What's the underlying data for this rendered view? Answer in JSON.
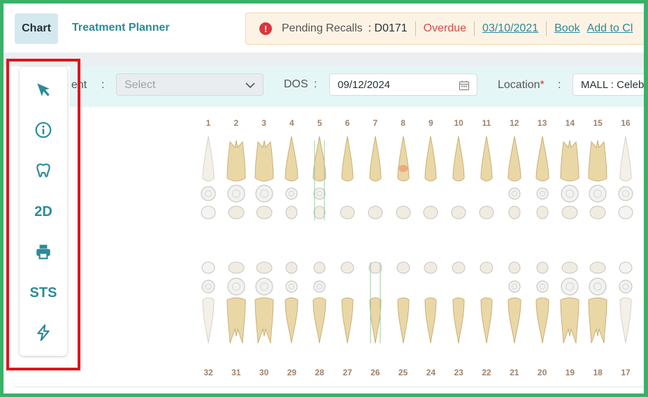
{
  "tabs": {
    "chart": "Chart",
    "planner": "Treatment Planner"
  },
  "recall": {
    "label": "Pending Recalls",
    "code": ": D0171",
    "status": "Overdue",
    "date": "03/10/2021",
    "book": "Book",
    "add": "Add to Cl"
  },
  "form": {
    "patient_label": "ent",
    "colon": ":",
    "select_placeholder": "Select",
    "dos_label": "DOS",
    "dos_value": "09/12/2024",
    "location_label": "Location",
    "required_mark": "*",
    "location_value": "MALL : Celeb"
  },
  "toolbar": {
    "sts": "STS",
    "two_d": "2D"
  },
  "teeth": {
    "upper": [
      "1",
      "2",
      "3",
      "4",
      "5",
      "6",
      "7",
      "8",
      "9",
      "10",
      "11",
      "12",
      "13",
      "14",
      "15",
      "16"
    ],
    "lower": [
      "32",
      "31",
      "30",
      "29",
      "28",
      "27",
      "26",
      "25",
      "24",
      "23",
      "22",
      "21",
      "20",
      "19",
      "18",
      "17"
    ]
  },
  "colors": {
    "accent": "#2b8a9a",
    "alert": "#d9363e",
    "tooth": "#e8d5a8",
    "highlight_border": "#e0141c"
  }
}
